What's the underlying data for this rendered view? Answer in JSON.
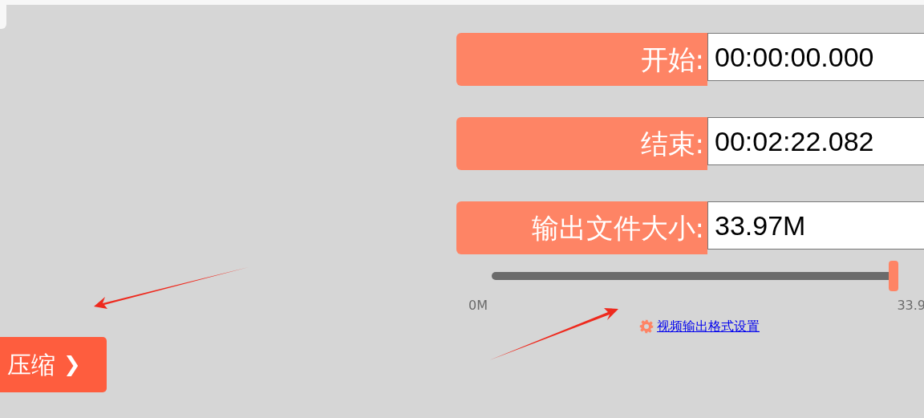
{
  "fields": [
    {
      "label": "开始:",
      "value": "00:00:00.000"
    },
    {
      "label": "结束:",
      "value": "00:02:22.082"
    },
    {
      "label": "输出文件大小:",
      "value": "33.97M"
    }
  ],
  "slider": {
    "level": 1,
    "min_label": "0M",
    "max_label": "33.9"
  },
  "settings_link": "视频输出格式设置",
  "compress_button": {
    "label": "压缩",
    "icon": "❯"
  }
}
